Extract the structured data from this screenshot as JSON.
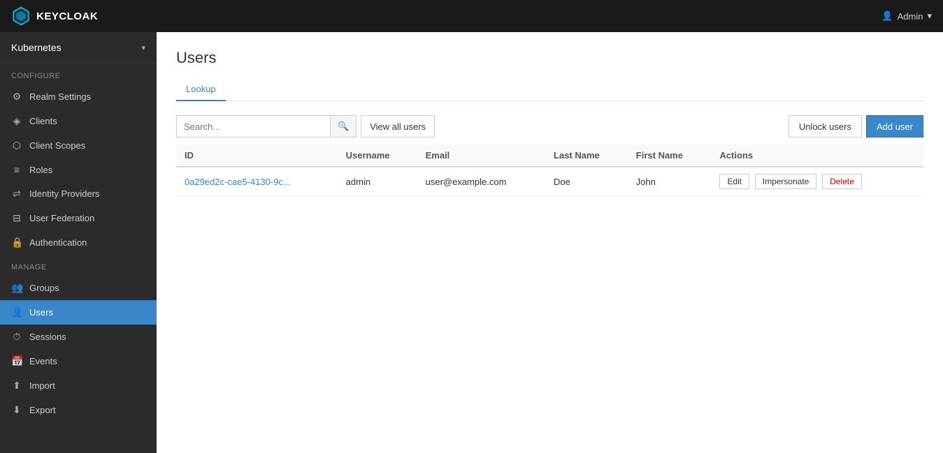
{
  "navbar": {
    "brand": "KEYCLOAK",
    "admin_label": "Admin",
    "dropdown_icon": "▾"
  },
  "sidebar": {
    "realm_name": "Kubernetes",
    "realm_chevron": "▾",
    "configure_label": "Configure",
    "manage_label": "Manage",
    "configure_items": [
      {
        "id": "realm-settings",
        "label": "Realm Settings",
        "icon": "⚙"
      },
      {
        "id": "clients",
        "label": "Clients",
        "icon": "◈"
      },
      {
        "id": "client-scopes",
        "label": "Client Scopes",
        "icon": "⬡"
      },
      {
        "id": "roles",
        "label": "Roles",
        "icon": "≡"
      },
      {
        "id": "identity-providers",
        "label": "Identity Providers",
        "icon": "⇌"
      },
      {
        "id": "user-federation",
        "label": "User Federation",
        "icon": "⊟"
      },
      {
        "id": "authentication",
        "label": "Authentication",
        "icon": "🔒"
      }
    ],
    "manage_items": [
      {
        "id": "groups",
        "label": "Groups",
        "icon": "👥"
      },
      {
        "id": "users",
        "label": "Users",
        "icon": "👤",
        "active": true
      },
      {
        "id": "sessions",
        "label": "Sessions",
        "icon": "⏱"
      },
      {
        "id": "events",
        "label": "Events",
        "icon": "📅"
      },
      {
        "id": "import",
        "label": "Import",
        "icon": "⬆"
      },
      {
        "id": "export",
        "label": "Export",
        "icon": "⬇"
      }
    ]
  },
  "page": {
    "title": "Users",
    "tab_lookup": "Lookup"
  },
  "toolbar": {
    "search_placeholder": "Search...",
    "search_icon": "🔍",
    "view_all_label": "View all users",
    "unlock_label": "Unlock users",
    "add_user_label": "Add user"
  },
  "table": {
    "columns": [
      "ID",
      "Username",
      "Email",
      "Last Name",
      "First Name",
      "Actions"
    ],
    "rows": [
      {
        "id": "0a29ed2c-cae5-4130-9c...",
        "username": "admin",
        "email": "user@example.com",
        "last_name": "Doe",
        "first_name": "John",
        "actions": [
          "Edit",
          "Impersonate",
          "Delete"
        ]
      }
    ]
  }
}
